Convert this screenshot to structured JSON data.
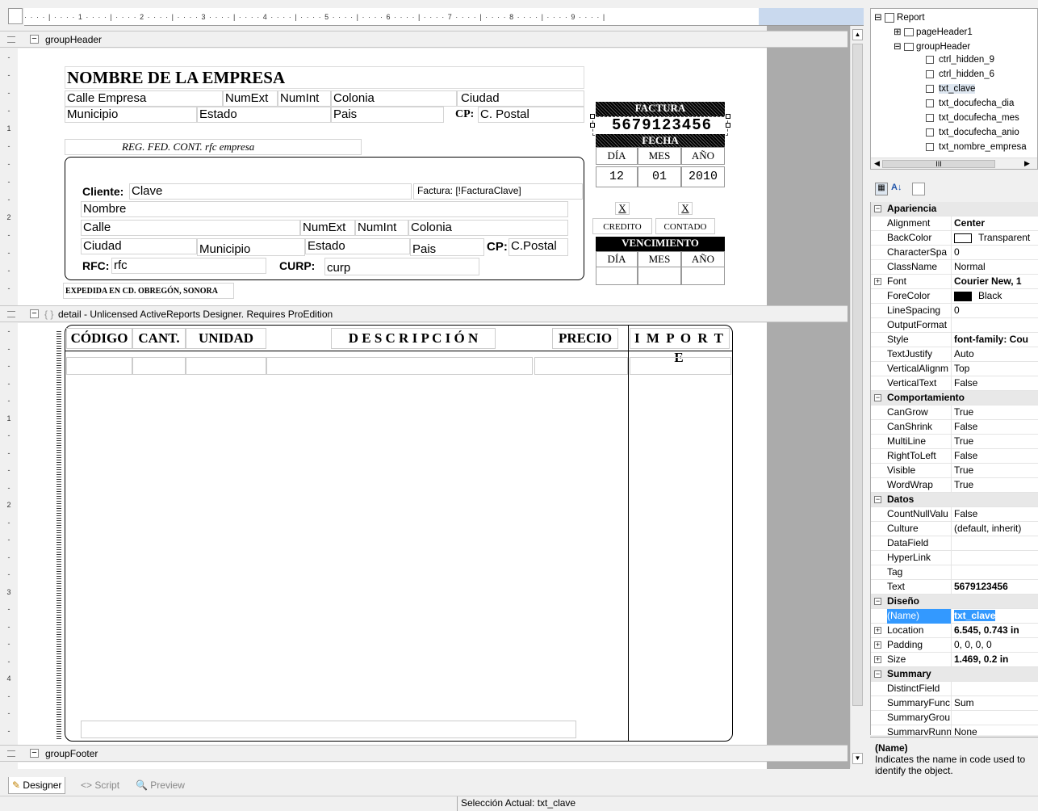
{
  "ruler_text": "· · · · | · · · · 1 · · · · | · · · · 2 · · · · | · · · · 3 · · · · | · · · · 4 · · · · | · · · · 5 · · · · | · · · · 6 · · · · | · · · · 7 · · · · | · · · · 8 · · · · | · · · · 9 · · · · |",
  "bands": {
    "group_header": "groupHeader",
    "detail": "detail  -  Unlicensed ActiveReports Designer. Requires ProEdition",
    "group_footer": "groupFooter"
  },
  "header": {
    "company_name": "NOMBRE DE LA EMPRESA",
    "calle_empresa": "Calle Empresa",
    "numext": "NumExt",
    "numint": "NumInt",
    "colonia": "Colonia",
    "ciudad": "Ciudad",
    "municipio": "Municipio",
    "estado": "Estado",
    "pais": "Pais",
    "cp_label": "CP:",
    "cp_value": "C. Postal",
    "rfc_label": "REG. FED. CONT.",
    "rfc_value": "rfc empresa",
    "factura_title": "FACTURA",
    "factura_number": "5679123456",
    "fecha_title": "FECHA",
    "dia": "DÍA",
    "mes": "MES",
    "anio": "AÑO",
    "dia_val": "12",
    "mes_val": "01",
    "anio_val": "2010",
    "credito_x": "X",
    "contado_x": "X",
    "credito": "CREDITO",
    "contado": "CONTADO",
    "vencimiento": "VENCIMIENTO",
    "expedida": "EXPEDIDA EN CD. OBREGÓN, SONORA"
  },
  "cliente": {
    "cliente_label": "Cliente:",
    "clave": "Clave",
    "factura_label": "Factura: [!FacturaClave]",
    "nombre": "Nombre",
    "calle": "Calle",
    "numext": "NumExt",
    "numint": "NumInt",
    "colonia": "Colonia",
    "ciudad": "Ciudad",
    "municipio": "Municipio",
    "estado": "Estado",
    "pais": "Pais",
    "cp_label": "CP:",
    "cp_value": "C.Postal",
    "rfc_label": "RFC:",
    "rfc_value": "rfc",
    "curp_label": "CURP:",
    "curp_value": "curp"
  },
  "detail": {
    "columns": [
      "CÓDIGO",
      "CANT.",
      "UNIDAD",
      "D E S C R I P C I Ó N",
      "PRECIO",
      "I M P O R T E"
    ]
  },
  "tabs": {
    "designer": "Designer",
    "script": "Script",
    "preview": "Preview"
  },
  "status": "Selección Actual: txt_clave",
  "tree": {
    "report": "Report",
    "page_header": "pageHeader1",
    "group_header": "groupHeader",
    "items": [
      "ctrl_hidden_9",
      "ctrl_hidden_6",
      "txt_clave",
      "txt_docufecha_dia",
      "txt_docufecha_mes",
      "txt_docufecha_anio",
      "txt_nombre_empresa"
    ],
    "scroll_label": "III"
  },
  "properties": [
    {
      "cat": "Apariencia"
    },
    {
      "name": "Alignment",
      "value": "Center",
      "bold": true
    },
    {
      "name": "BackColor",
      "value": "Transparent",
      "swatch": "#ffffff"
    },
    {
      "name": "CharacterSpa",
      "value": "0"
    },
    {
      "name": "ClassName",
      "value": "Normal"
    },
    {
      "name": "Font",
      "value": "Courier New, 1",
      "bold": true,
      "expand": true
    },
    {
      "name": "ForeColor",
      "value": "Black",
      "swatch": "#000000"
    },
    {
      "name": "LineSpacing",
      "value": "0"
    },
    {
      "name": "OutputFormat",
      "value": ""
    },
    {
      "name": "Style",
      "value": "font-family: Cou",
      "bold": true
    },
    {
      "name": "TextJustify",
      "value": "Auto"
    },
    {
      "name": "VerticalAlignm",
      "value": "Top"
    },
    {
      "name": "VerticalText",
      "value": "False"
    },
    {
      "cat": "Comportamiento"
    },
    {
      "name": "CanGrow",
      "value": "True"
    },
    {
      "name": "CanShrink",
      "value": "False"
    },
    {
      "name": "MultiLine",
      "value": "True"
    },
    {
      "name": "RightToLeft",
      "value": "False"
    },
    {
      "name": "Visible",
      "value": "True"
    },
    {
      "name": "WordWrap",
      "value": "True"
    },
    {
      "cat": "Datos"
    },
    {
      "name": "CountNullValu",
      "value": "False"
    },
    {
      "name": "Culture",
      "value": "(default, inherit)"
    },
    {
      "name": "DataField",
      "value": ""
    },
    {
      "name": "HyperLink",
      "value": ""
    },
    {
      "name": "Tag",
      "value": ""
    },
    {
      "name": "Text",
      "value": "5679123456",
      "bold": true
    },
    {
      "cat": "Diseño"
    },
    {
      "name": "(Name)",
      "value": "txt_clave",
      "selected": true
    },
    {
      "name": "Location",
      "value": "6.545, 0.743 in",
      "bold": true,
      "expand": true
    },
    {
      "name": "Padding",
      "value": "0, 0, 0, 0",
      "expand": true
    },
    {
      "name": "Size",
      "value": "1.469, 0.2 in",
      "bold": true,
      "expand": true
    },
    {
      "cat": "Summary"
    },
    {
      "name": "DistinctField",
      "value": ""
    },
    {
      "name": "SummaryFunc",
      "value": "Sum"
    },
    {
      "name": "SummaryGrou",
      "value": ""
    },
    {
      "name": "SummaryRunn",
      "value": "None"
    }
  ],
  "description": {
    "title": "(Name)",
    "text": "Indicates the name in code used to identify the object."
  }
}
